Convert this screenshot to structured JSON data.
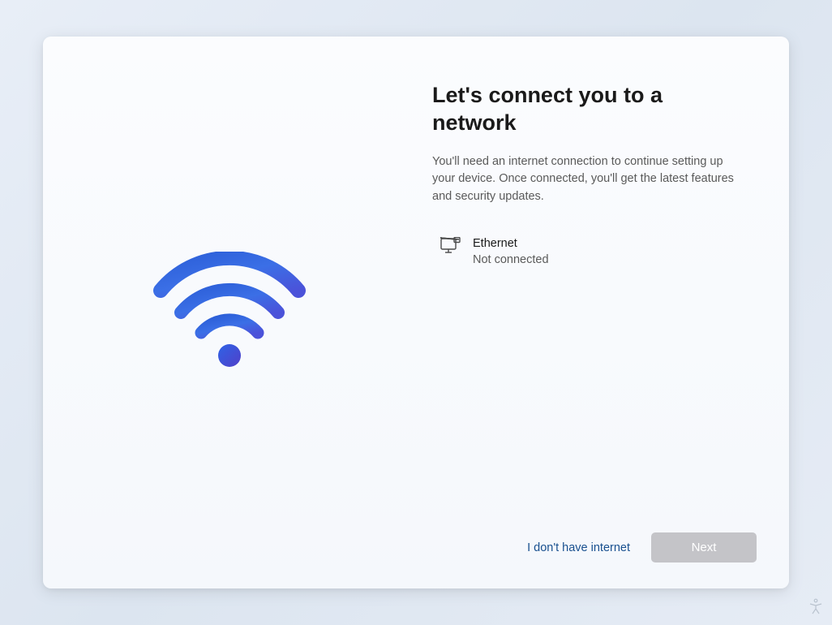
{
  "heading": "Let's connect you to a network",
  "description": "You'll need an internet connection to continue setting up your device. Once connected, you'll get the latest features and security updates.",
  "networks": [
    {
      "name": "Ethernet",
      "status": "Not connected"
    }
  ],
  "actions": {
    "skip_label": "I don't have internet",
    "next_label": "Next"
  }
}
